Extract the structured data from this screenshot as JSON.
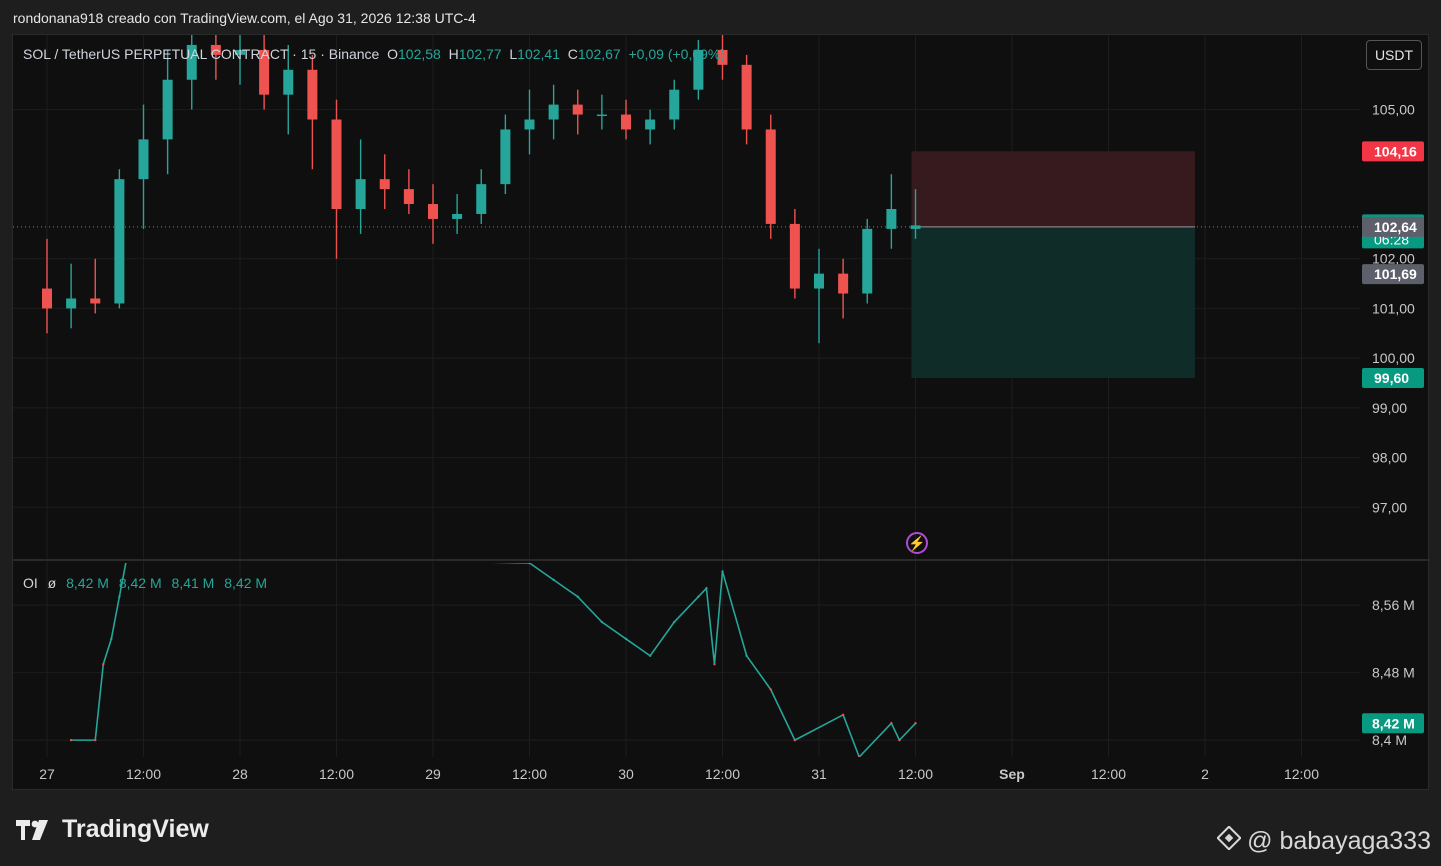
{
  "header": {
    "credit": "rondonana918 creado con TradingView.com, el Ago 31, 2026 12:38 UTC-4"
  },
  "legend": {
    "symbol": "SOL / TetherUS PERPETUAL CONTRACT · 15 · Binance",
    "o_label": "O",
    "o_value": "102,58",
    "h_label": "H",
    "h_value": "102,77",
    "l_label": "L",
    "l_value": "102,41",
    "c_label": "C",
    "c_value": "102,67",
    "change": "+0,09 (+0,09%)"
  },
  "currency_button": "USDT",
  "oi_legend": {
    "label": "OI",
    "symbol": "ø",
    "values": [
      "8,42 M",
      "8,42 M",
      "8,41 M",
      "8,42 M"
    ]
  },
  "brand": "TradingView",
  "watermark": "@ babayaga333",
  "colors": {
    "up": "#26a69a",
    "down": "#ef5350",
    "background": "#0f0f0f",
    "stop_zone": "#3b1c1f",
    "target_zone": "#11302b",
    "panel_sep": "#2a2a2a",
    "crosshair_label": "#5d606b"
  },
  "chart_data": [
    {
      "type": "candlestick",
      "title": "SOL / TetherUS PERPETUAL CONTRACT · 15 · Binance",
      "ylim": [
        96.0,
        106.5
      ],
      "y_ticks": [
        {
          "value": 105,
          "label": "105,00"
        },
        {
          "value": 102,
          "label": "102,00"
        },
        {
          "value": 101,
          "label": "101,00"
        },
        {
          "value": 100,
          "label": "100,00"
        },
        {
          "value": 99,
          "label": "99,00"
        },
        {
          "value": 98,
          "label": "98,00"
        },
        {
          "value": 97,
          "label": "97,00"
        }
      ],
      "x_ticks": [
        "27",
        "12:00",
        "28",
        "12:00",
        "29",
        "12:00",
        "30",
        "12:00",
        "31",
        "12:00",
        "Sep",
        "12:00",
        "2",
        "12:00"
      ],
      "price_labels": [
        {
          "label": "104,16",
          "value": 104.16,
          "color": "#f23645"
        },
        {
          "label": "102,67",
          "sub": "06:28",
          "value": 102.67,
          "color": "#089981"
        },
        {
          "label": "102,64",
          "value": 102.64,
          "color": "#5d606b"
        },
        {
          "label": "101,69",
          "value": 101.69,
          "color": "#5d606b"
        },
        {
          "label": "99,60",
          "value": 99.6,
          "color": "#089981"
        }
      ],
      "position": {
        "entry": 102.64,
        "stop": 104.16,
        "target": 99.6,
        "start_time": "31 12:00",
        "end_time": "2 00:00"
      },
      "series": [
        {
          "time": "27 00:00",
          "open": 101.4,
          "high": 102.4,
          "low": 100.5,
          "close": 101.0
        },
        {
          "time": "27 03:00",
          "open": 101.0,
          "high": 101.9,
          "low": 100.6,
          "close": 101.2
        },
        {
          "time": "27 06:00",
          "open": 101.2,
          "high": 102.0,
          "low": 100.9,
          "close": 101.1
        },
        {
          "time": "27 09:00",
          "open": 101.1,
          "high": 103.8,
          "low": 101.0,
          "close": 103.6
        },
        {
          "time": "27 12:00",
          "open": 103.6,
          "high": 105.1,
          "low": 102.6,
          "close": 104.4
        },
        {
          "time": "27 15:00",
          "open": 104.4,
          "high": 106.2,
          "low": 103.7,
          "close": 105.6
        },
        {
          "time": "27 18:00",
          "open": 105.6,
          "high": 106.6,
          "low": 105.0,
          "close": 106.3
        },
        {
          "time": "27 21:00",
          "open": 106.3,
          "high": 106.8,
          "low": 105.6,
          "close": 106.1
        },
        {
          "time": "28 00:00",
          "open": 106.1,
          "high": 106.8,
          "low": 105.5,
          "close": 106.2
        },
        {
          "time": "28 03:00",
          "open": 106.2,
          "high": 106.6,
          "low": 105.0,
          "close": 105.3
        },
        {
          "time": "28 06:00",
          "open": 105.3,
          "high": 106.3,
          "low": 104.5,
          "close": 105.8
        },
        {
          "time": "28 09:00",
          "open": 105.8,
          "high": 106.1,
          "low": 103.8,
          "close": 104.8
        },
        {
          "time": "28 12:00",
          "open": 104.8,
          "high": 105.2,
          "low": 102.0,
          "close": 103.0
        },
        {
          "time": "28 15:00",
          "open": 103.0,
          "high": 104.4,
          "low": 102.5,
          "close": 103.6
        },
        {
          "time": "28 18:00",
          "open": 103.6,
          "high": 104.1,
          "low": 103.0,
          "close": 103.4
        },
        {
          "time": "28 21:00",
          "open": 103.4,
          "high": 103.8,
          "low": 102.9,
          "close": 103.1
        },
        {
          "time": "29 00:00",
          "open": 103.1,
          "high": 103.5,
          "low": 102.3,
          "close": 102.8
        },
        {
          "time": "29 03:00",
          "open": 102.8,
          "high": 103.3,
          "low": 102.5,
          "close": 102.9
        },
        {
          "time": "29 06:00",
          "open": 102.9,
          "high": 103.8,
          "low": 102.7,
          "close": 103.5
        },
        {
          "time": "29 09:00",
          "open": 103.5,
          "high": 104.9,
          "low": 103.3,
          "close": 104.6
        },
        {
          "time": "29 12:00",
          "open": 104.6,
          "high": 105.4,
          "low": 104.1,
          "close": 104.8
        },
        {
          "time": "29 15:00",
          "open": 104.8,
          "high": 105.5,
          "low": 104.4,
          "close": 105.1
        },
        {
          "time": "29 18:00",
          "open": 105.1,
          "high": 105.4,
          "low": 104.5,
          "close": 104.9
        },
        {
          "time": "29 21:00",
          "open": 104.9,
          "high": 105.3,
          "low": 104.6,
          "close": 104.9
        },
        {
          "time": "30 00:00",
          "open": 104.9,
          "high": 105.2,
          "low": 104.4,
          "close": 104.6
        },
        {
          "time": "30 03:00",
          "open": 104.6,
          "high": 105.0,
          "low": 104.3,
          "close": 104.8
        },
        {
          "time": "30 06:00",
          "open": 104.8,
          "high": 105.6,
          "low": 104.6,
          "close": 105.4
        },
        {
          "time": "30 09:00",
          "open": 105.4,
          "high": 106.4,
          "low": 105.2,
          "close": 106.2
        },
        {
          "time": "30 12:00",
          "open": 106.2,
          "high": 106.6,
          "low": 105.6,
          "close": 105.9
        },
        {
          "time": "30 15:00",
          "open": 105.9,
          "high": 106.1,
          "low": 104.3,
          "close": 104.6
        },
        {
          "time": "30 18:00",
          "open": 104.6,
          "high": 104.9,
          "low": 102.4,
          "close": 102.7
        },
        {
          "time": "30 21:00",
          "open": 102.7,
          "high": 103.0,
          "low": 101.2,
          "close": 101.4
        },
        {
          "time": "31 00:00",
          "open": 101.4,
          "high": 102.2,
          "low": 100.3,
          "close": 101.7
        },
        {
          "time": "31 03:00",
          "open": 101.7,
          "high": 102.0,
          "low": 100.8,
          "close": 101.3
        },
        {
          "time": "31 06:00",
          "open": 101.3,
          "high": 102.8,
          "low": 101.1,
          "close": 102.6
        },
        {
          "time": "31 09:00",
          "open": 102.6,
          "high": 103.7,
          "low": 102.2,
          "close": 103.0
        },
        {
          "time": "31 12:00",
          "open": 102.6,
          "high": 103.4,
          "low": 102.4,
          "close": 102.67
        }
      ]
    },
    {
      "type": "line",
      "title": "OI",
      "ylim": [
        8.38,
        8.61
      ],
      "y_ticks": [
        {
          "value": 8.56,
          "label": "8,56 M"
        },
        {
          "value": 8.48,
          "label": "8,48 M"
        },
        {
          "value": 8.4,
          "label": "8,4 M"
        }
      ],
      "current": {
        "label": "8,42 M",
        "value": 8.42
      },
      "series": [
        {
          "name": "OI",
          "points": [
            {
              "time": "27 03:00",
              "value": 8.4
            },
            {
              "time": "27 06:00",
              "value": 8.4
            },
            {
              "time": "27 07:00",
              "value": 8.49
            },
            {
              "time": "27 08:00",
              "value": 8.52
            },
            {
              "time": "27 09:00",
              "value": 8.57
            },
            {
              "time": "27 10:00",
              "value": 8.62
            },
            {
              "time": "29 12:00",
              "value": 8.61
            },
            {
              "time": "29 15:00",
              "value": 8.59
            },
            {
              "time": "29 18:00",
              "value": 8.57
            },
            {
              "time": "29 21:00",
              "value": 8.54
            },
            {
              "time": "30 00:00",
              "value": 8.52
            },
            {
              "time": "30 03:00",
              "value": 8.5
            },
            {
              "time": "30 06:00",
              "value": 8.54
            },
            {
              "time": "30 09:00",
              "value": 8.57
            },
            {
              "time": "30 10:00",
              "value": 8.58
            },
            {
              "time": "30 11:00",
              "value": 8.49
            },
            {
              "time": "30 12:00",
              "value": 8.6
            },
            {
              "time": "30 15:00",
              "value": 8.5
            },
            {
              "time": "30 18:00",
              "value": 8.46
            },
            {
              "time": "30 21:00",
              "value": 8.4
            },
            {
              "time": "31 03:00",
              "value": 8.43
            },
            {
              "time": "31 05:00",
              "value": 8.38
            },
            {
              "time": "31 09:00",
              "value": 8.42
            },
            {
              "time": "31 10:00",
              "value": 8.4
            },
            {
              "time": "31 12:00",
              "value": 8.42
            }
          ]
        }
      ]
    }
  ]
}
